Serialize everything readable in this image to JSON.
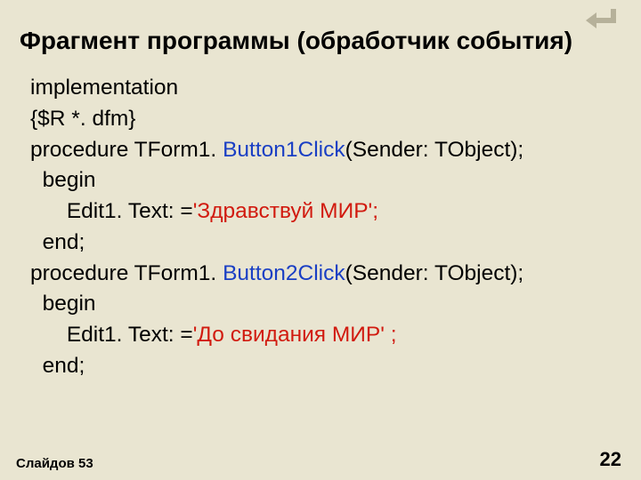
{
  "title": "Фрагмент программы (обработчик события)",
  "code": {
    "l1": "implementation",
    "l2": "{$R *. dfm}",
    "l3a": "procedure TForm1. ",
    "l3b": "Button1Click",
    "l3c": "(Sender: TObject);",
    "l4": "  begin",
    "l5a": "      Edit1. Text: =",
    "l5b": "'Здравствуй МИР'; ",
    "l6": "  end;",
    "l7a": "procedure TForm1. ",
    "l7b": "Button2Click",
    "l7c": "(Sender: TObject);",
    "l8": "  begin",
    "l9a": "      Edit1. Text: =",
    "l9b": "'До свидания МИР' ; ",
    "l10": "  end;"
  },
  "footer": {
    "slides": "Слайдов 53",
    "page": "22"
  },
  "icon": {
    "name": "return-icon"
  }
}
